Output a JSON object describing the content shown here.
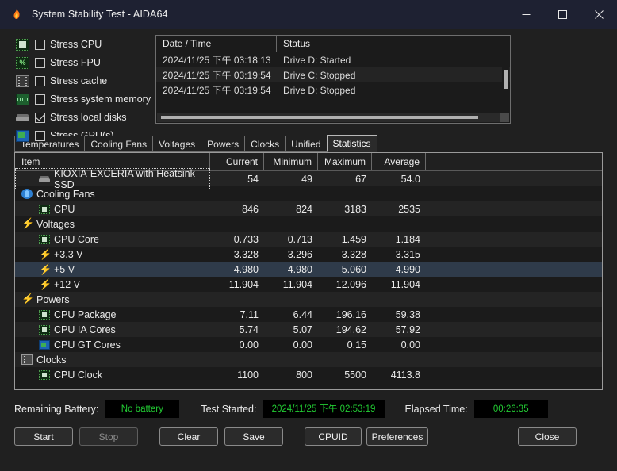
{
  "window": {
    "title": "System Stability Test - AIDA64",
    "icon": "flame-icon",
    "minimize_label": "Minimize",
    "maximize_label": "Maximize",
    "close_label": "Close"
  },
  "stress_options": [
    {
      "label": "Stress CPU",
      "icon": "cpu-icon",
      "checked": false
    },
    {
      "label": "Stress FPU",
      "icon": "fpu-icon",
      "checked": false
    },
    {
      "label": "Stress cache",
      "icon": "cache-icon",
      "checked": false
    },
    {
      "label": "Stress system memory",
      "icon": "memory-icon",
      "checked": false
    },
    {
      "label": "Stress local disks",
      "icon": "disk-icon",
      "checked": true
    },
    {
      "label": "Stress GPU(s)",
      "icon": "gpu-icon",
      "checked": false
    }
  ],
  "log": {
    "headers": {
      "datetime": "Date / Time",
      "status": "Status"
    },
    "rows": [
      {
        "datetime": "2024/11/25 下午 03:18:13",
        "status": "Drive D: Started"
      },
      {
        "datetime": "2024/11/25 下午 03:19:54",
        "status": "Drive C: Stopped"
      },
      {
        "datetime": "2024/11/25 下午 03:19:54",
        "status": "Drive D: Stopped"
      }
    ]
  },
  "tabs": [
    {
      "label": "Temperatures",
      "active": false
    },
    {
      "label": "Cooling Fans",
      "active": false
    },
    {
      "label": "Voltages",
      "active": false
    },
    {
      "label": "Powers",
      "active": false
    },
    {
      "label": "Clocks",
      "active": false
    },
    {
      "label": "Unified",
      "active": false
    },
    {
      "label": "Statistics",
      "active": true
    }
  ],
  "statistics": {
    "headers": [
      "Item",
      "Current",
      "Minimum",
      "Maximum",
      "Average"
    ],
    "rows": [
      {
        "kind": "leaf",
        "icon": "disk-icon",
        "label": "KIOXIA-EXCERIA with Heatsink SSD",
        "current": "54",
        "minimum": "49",
        "maximum": "67",
        "average": "54.0",
        "selected": false,
        "focused": true,
        "alt": true
      },
      {
        "kind": "group",
        "icon": "fan-icon",
        "label": "Cooling Fans",
        "current": "",
        "minimum": "",
        "maximum": "",
        "average": "",
        "selected": false,
        "focused": false,
        "alt": false
      },
      {
        "kind": "leaf",
        "icon": "chip-icon",
        "label": "CPU",
        "current": "846",
        "minimum": "824",
        "maximum": "3183",
        "average": "2535",
        "selected": false,
        "focused": false,
        "alt": true
      },
      {
        "kind": "group",
        "icon": "bolt-icon",
        "label": "Voltages",
        "current": "",
        "minimum": "",
        "maximum": "",
        "average": "",
        "selected": false,
        "focused": false,
        "alt": false
      },
      {
        "kind": "leaf",
        "icon": "chip-icon",
        "label": "CPU Core",
        "current": "0.733",
        "minimum": "0.713",
        "maximum": "1.459",
        "average": "1.184",
        "selected": false,
        "focused": false,
        "alt": true
      },
      {
        "kind": "leaf",
        "icon": "bolt-icon",
        "label": "+3.3 V",
        "current": "3.328",
        "minimum": "3.296",
        "maximum": "3.328",
        "average": "3.315",
        "selected": false,
        "focused": false,
        "alt": false
      },
      {
        "kind": "leaf",
        "icon": "bolt-icon",
        "label": "+5 V",
        "current": "4.980",
        "minimum": "4.980",
        "maximum": "5.060",
        "average": "4.990",
        "selected": true,
        "focused": false,
        "alt": true
      },
      {
        "kind": "leaf",
        "icon": "bolt-icon",
        "label": "+12 V",
        "current": "11.904",
        "minimum": "11.904",
        "maximum": "12.096",
        "average": "11.904",
        "selected": false,
        "focused": false,
        "alt": false
      },
      {
        "kind": "group",
        "icon": "bolt-icon",
        "label": "Powers",
        "current": "",
        "minimum": "",
        "maximum": "",
        "average": "",
        "selected": false,
        "focused": false,
        "alt": true
      },
      {
        "kind": "leaf",
        "icon": "chip-icon",
        "label": "CPU Package",
        "current": "7.11",
        "minimum": "6.44",
        "maximum": "196.16",
        "average": "59.38",
        "selected": false,
        "focused": false,
        "alt": false
      },
      {
        "kind": "leaf",
        "icon": "chip-icon",
        "label": "CPU IA Cores",
        "current": "5.74",
        "minimum": "5.07",
        "maximum": "194.62",
        "average": "57.92",
        "selected": false,
        "focused": false,
        "alt": true
      },
      {
        "kind": "leaf",
        "icon": "gpu-icon",
        "label": "CPU GT Cores",
        "current": "0.00",
        "minimum": "0.00",
        "maximum": "0.15",
        "average": "0.00",
        "selected": false,
        "focused": false,
        "alt": false
      },
      {
        "kind": "group",
        "icon": "clock-icon",
        "label": "Clocks",
        "current": "",
        "minimum": "",
        "maximum": "",
        "average": "",
        "selected": false,
        "focused": false,
        "alt": true
      },
      {
        "kind": "leaf",
        "icon": "chip-icon",
        "label": "CPU Clock",
        "current": "1100",
        "minimum": "800",
        "maximum": "5500",
        "average": "4113.8",
        "selected": false,
        "focused": false,
        "alt": false
      }
    ]
  },
  "statusbar": {
    "battery_label": "Remaining Battery:",
    "battery_value": "No battery",
    "started_label": "Test Started:",
    "started_value": "2024/11/25 下午 02:53:19",
    "elapsed_label": "Elapsed Time:",
    "elapsed_value": "00:26:35",
    "value_color": "#22cc33"
  },
  "buttons": [
    {
      "label": "Start",
      "disabled": false
    },
    {
      "label": "Stop",
      "disabled": true
    },
    {
      "label": "Clear",
      "disabled": false
    },
    {
      "label": "Save",
      "disabled": false
    },
    {
      "label": "CPUID",
      "disabled": false
    },
    {
      "label": "Preferences",
      "disabled": false
    },
    {
      "label": "Close",
      "disabled": false
    }
  ]
}
